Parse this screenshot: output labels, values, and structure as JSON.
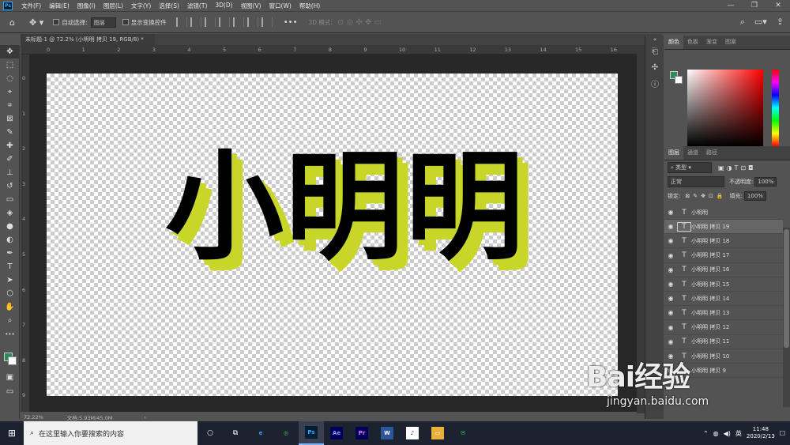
{
  "menubar": {
    "logo": "Ps",
    "items": [
      "文件(F)",
      "编辑(E)",
      "图像(I)",
      "图层(L)",
      "文字(Y)",
      "选择(S)",
      "滤镜(T)",
      "3D(D)",
      "视图(V)",
      "窗口(W)",
      "帮助(H)"
    ],
    "window_buttons": [
      "—",
      "❐",
      "✕"
    ]
  },
  "options": {
    "auto_select_label": "自动选择:",
    "auto_select_value": "图层",
    "show_transform_label": "显示变换控件",
    "mode_3d_label": "3D 模式:",
    "more": "•••"
  },
  "document": {
    "tab_title": "未标题-1 @ 72.2% (小明明 拷贝 19, RGB/8) *",
    "zoom": "72.22%",
    "doc_size": "文档:5.93M/45.0M",
    "canvas_text": "小明明",
    "text_colors": {
      "face": "#000000",
      "shadow": "#c8d62a"
    }
  },
  "rulers": {
    "top": [
      "0",
      "1",
      "2",
      "3",
      "4",
      "5",
      "6",
      "7",
      "8",
      "9",
      "10",
      "11",
      "12",
      "13",
      "14",
      "15",
      "16"
    ],
    "left": [
      "0",
      "1",
      "2",
      "3",
      "4",
      "5",
      "6",
      "7",
      "8",
      "9"
    ]
  },
  "tools": [
    {
      "icon": "move-icon",
      "glyph": "✥"
    },
    {
      "icon": "marquee-icon",
      "glyph": "⬚"
    },
    {
      "icon": "lasso-icon",
      "glyph": "◌"
    },
    {
      "icon": "quick-select-icon",
      "glyph": "⌖"
    },
    {
      "icon": "crop-icon",
      "glyph": "⌗"
    },
    {
      "icon": "frame-icon",
      "glyph": "⊠"
    },
    {
      "icon": "eyedropper-icon",
      "glyph": "✎"
    },
    {
      "icon": "healing-icon",
      "glyph": "✚"
    },
    {
      "icon": "brush-icon",
      "glyph": "✐"
    },
    {
      "icon": "stamp-icon",
      "glyph": "⊥"
    },
    {
      "icon": "history-brush-icon",
      "glyph": "↺"
    },
    {
      "icon": "eraser-icon",
      "glyph": "▭"
    },
    {
      "icon": "bucket-icon",
      "glyph": "◈"
    },
    {
      "icon": "blur-icon",
      "glyph": "●"
    },
    {
      "icon": "dodge-icon",
      "glyph": "◐"
    },
    {
      "icon": "pen-icon",
      "glyph": "✒"
    },
    {
      "icon": "type-icon",
      "glyph": "T"
    },
    {
      "icon": "path-select-icon",
      "glyph": "➤"
    },
    {
      "icon": "shape-icon",
      "glyph": "⬡"
    },
    {
      "icon": "hand-icon",
      "glyph": "✋"
    },
    {
      "icon": "zoom-icon",
      "glyph": "⌕"
    },
    {
      "icon": "more-tools-icon",
      "glyph": "•••"
    }
  ],
  "panels": {
    "color_tabs": [
      "颜色",
      "色板",
      "渐变",
      "图案"
    ],
    "layer_tabs": [
      "图层",
      "通道",
      "路径"
    ],
    "filter_label": "类型",
    "blend_mode": "正常",
    "opacity_label": "不透明度:",
    "opacity_value": "100%",
    "lock_label": "锁定:",
    "fill_label": "填充:",
    "fill_value": "100%"
  },
  "layers": [
    {
      "name": "小明明",
      "selected": false
    },
    {
      "name": "小明明 拷贝 19",
      "selected": true
    },
    {
      "name": "小明明 拷贝 18",
      "selected": false
    },
    {
      "name": "小明明 拷贝 17",
      "selected": false
    },
    {
      "name": "小明明 拷贝 16",
      "selected": false
    },
    {
      "name": "小明明 拷贝 15",
      "selected": false
    },
    {
      "name": "小明明 拷贝 14",
      "selected": false
    },
    {
      "name": "小明明 拷贝 13",
      "selected": false
    },
    {
      "name": "小明明 拷贝 12",
      "selected": false
    },
    {
      "name": "小明明 拷贝 11",
      "selected": false
    },
    {
      "name": "小明明 拷贝 10",
      "selected": false
    },
    {
      "name": "小明明 拷贝 9",
      "selected": false
    }
  ],
  "taskbar": {
    "search_placeholder": "在这里输入你要搜索的内容",
    "apps": [
      {
        "label": "e",
        "bg": "#1c2230",
        "fg": "#3c9bff"
      },
      {
        "label": "◎",
        "bg": "#1c2230",
        "fg": "#4cc34c"
      },
      {
        "label": "Ps",
        "bg": "#001e36",
        "fg": "#31a8ff"
      },
      {
        "label": "Ae",
        "bg": "#00005b",
        "fg": "#9999ff"
      },
      {
        "label": "Pr",
        "bg": "#00005b",
        "fg": "#ea77ff"
      },
      {
        "label": "W",
        "bg": "#2b579a",
        "fg": "#ffffff"
      },
      {
        "label": "♪",
        "bg": "#ffffff",
        "fg": "#333333"
      },
      {
        "label": "▭",
        "bg": "#e8b23a",
        "fg": "#ffffff"
      },
      {
        "label": "✉",
        "bg": "#1c2230",
        "fg": "#3bc45a"
      }
    ],
    "ime": "英",
    "time": "11:48",
    "date": "2020/2/13"
  },
  "watermark": {
    "main": "Bai经验",
    "sub": "jingyan.baidu.com"
  }
}
